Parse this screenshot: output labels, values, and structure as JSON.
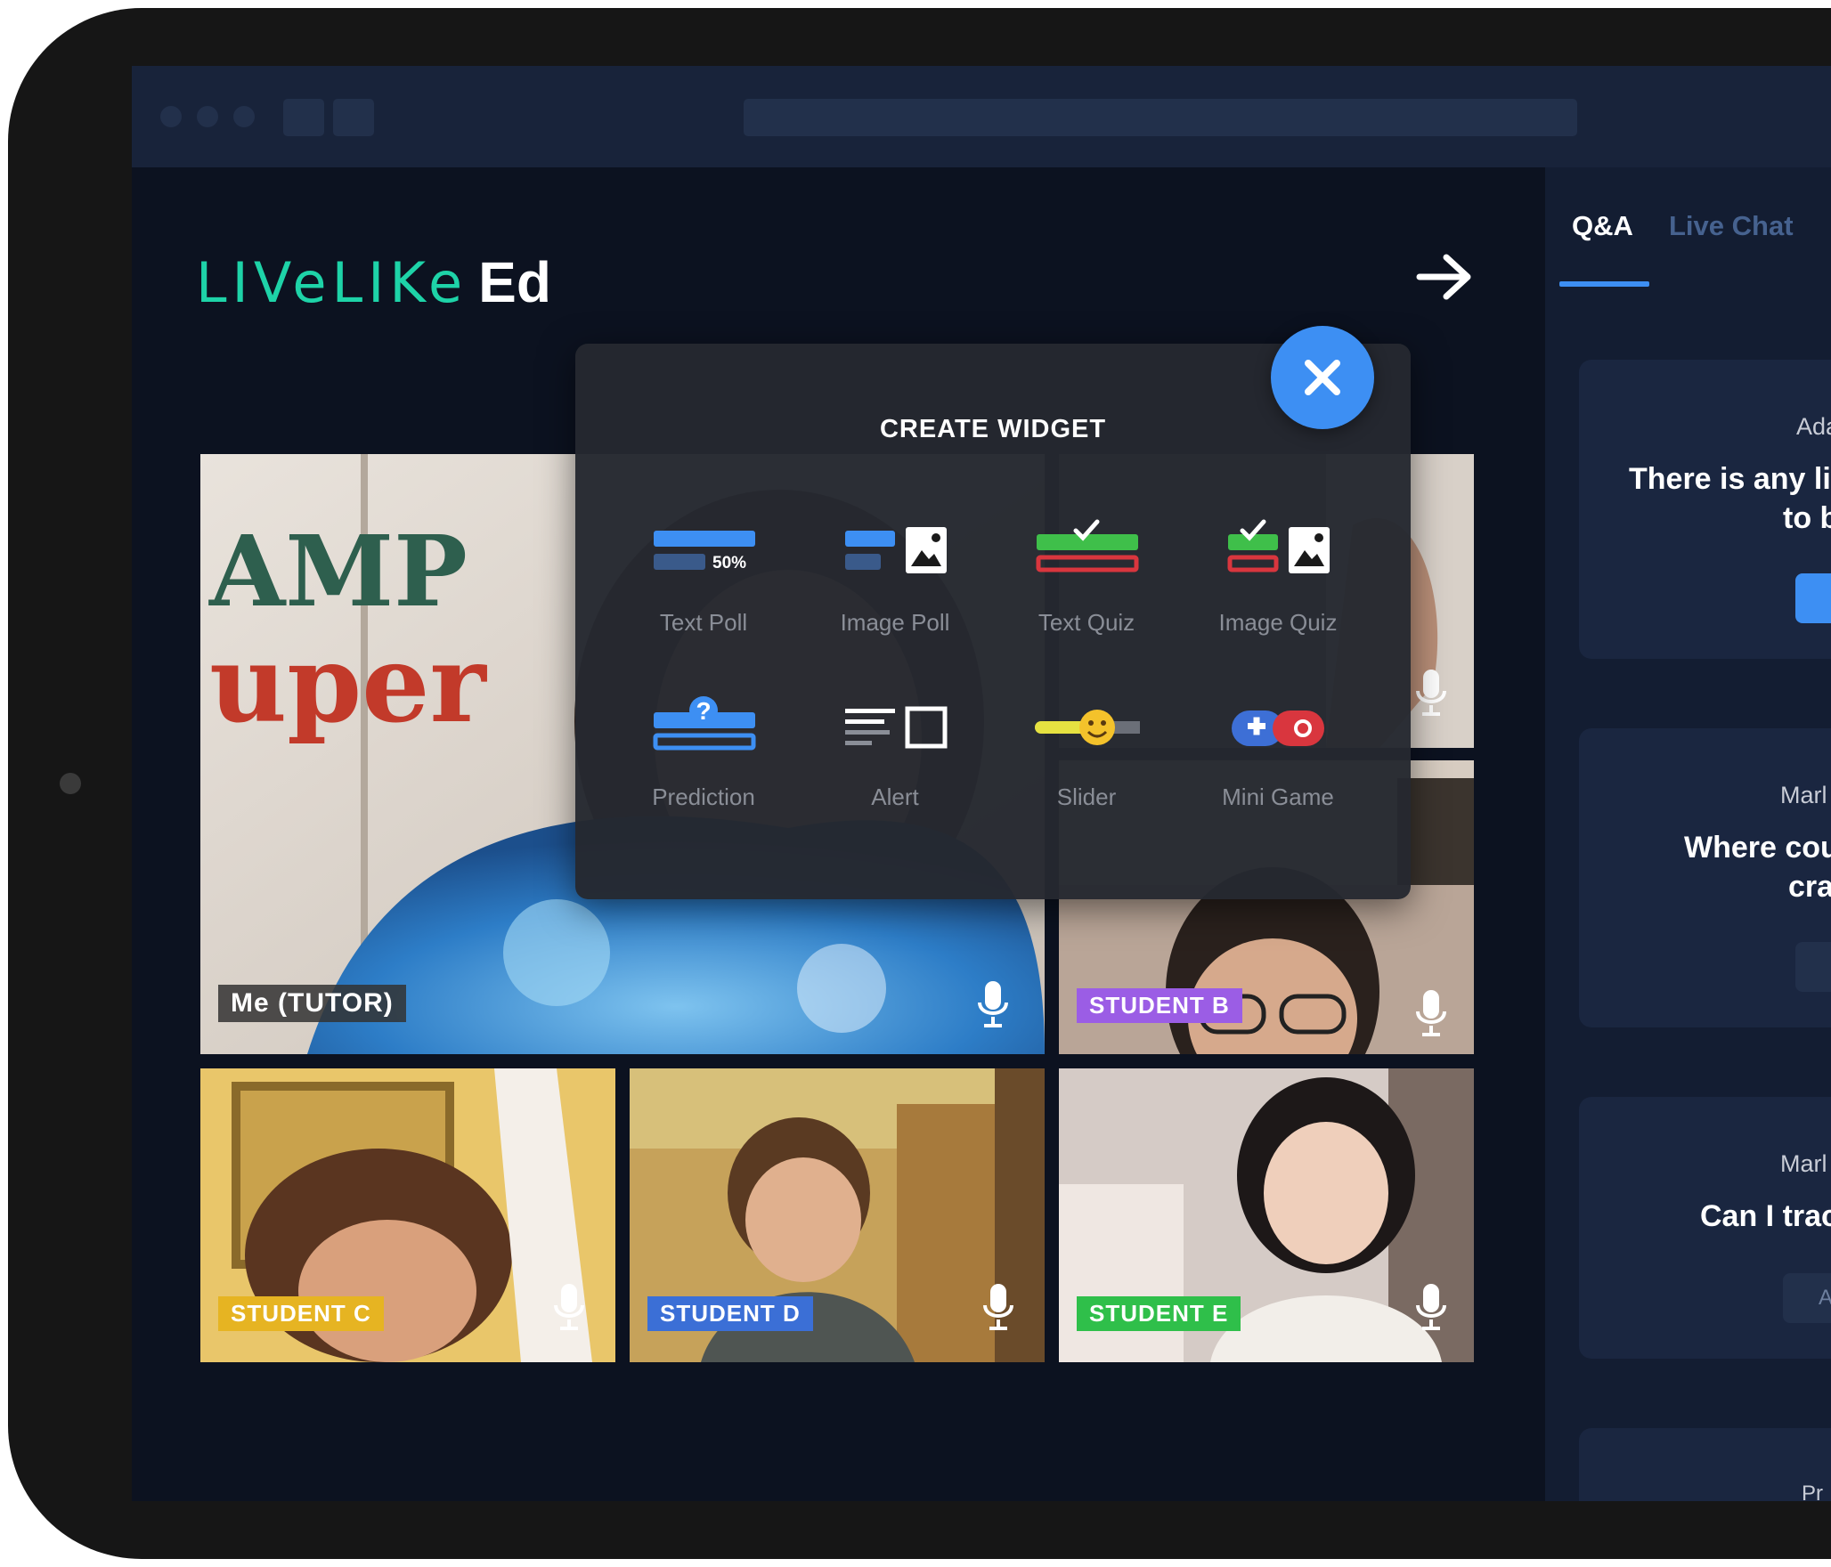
{
  "brand": {
    "logo_live": "LIVeLIKe",
    "logo_ed": "Ed"
  },
  "widget_panel": {
    "title": "CREATE WIDGET",
    "items": [
      {
        "label": "Text Poll",
        "icon": "text-poll-icon"
      },
      {
        "label": "Image Poll",
        "icon": "image-poll-icon"
      },
      {
        "label": "Text Quiz",
        "icon": "text-quiz-icon"
      },
      {
        "label": "Image Quiz",
        "icon": "image-quiz-icon"
      },
      {
        "label": "Prediction",
        "icon": "prediction-icon"
      },
      {
        "label": "Alert",
        "icon": "alert-icon"
      },
      {
        "label": "Slider",
        "icon": "slider-icon"
      },
      {
        "label": "Mini Game",
        "icon": "mini-game-icon"
      }
    ],
    "text_poll_percent": "50%",
    "close_icon": "close-icon"
  },
  "video_tiles": [
    {
      "label": "Me (TUTOR)",
      "label_color": "#3a3a3a"
    },
    {
      "label": "STUDENT B",
      "label_color": "#9b5de5"
    },
    {
      "label": "STUDENT C",
      "label_color": "#e6b422"
    },
    {
      "label": "STUDENT D",
      "label_color": "#3b6fd6"
    },
    {
      "label": "STUDENT E",
      "label_color": "#2fbf4a"
    }
  ],
  "sidebar": {
    "tabs": [
      {
        "label": "Q&A",
        "active": true
      },
      {
        "label": "Live Chat",
        "active": false
      }
    ],
    "cards": [
      {
        "author": "Ada",
        "question_line1": "There is any li",
        "question_line2": "to b"
      },
      {
        "author": "Marl",
        "question_line1": "Where cou",
        "question_line2": "cra"
      },
      {
        "author": "Marl",
        "question_line1": "Can I trac",
        "question_line2": "",
        "button_text": "A"
      },
      {
        "author": "Pr",
        "question_line1": "",
        "question_line2": ""
      }
    ]
  },
  "colors": {
    "accent": "#3d8ff3",
    "brand_green": "#1ed3a8",
    "screen_bg": "#0c1220",
    "sidebar_bg": "#131d32"
  }
}
